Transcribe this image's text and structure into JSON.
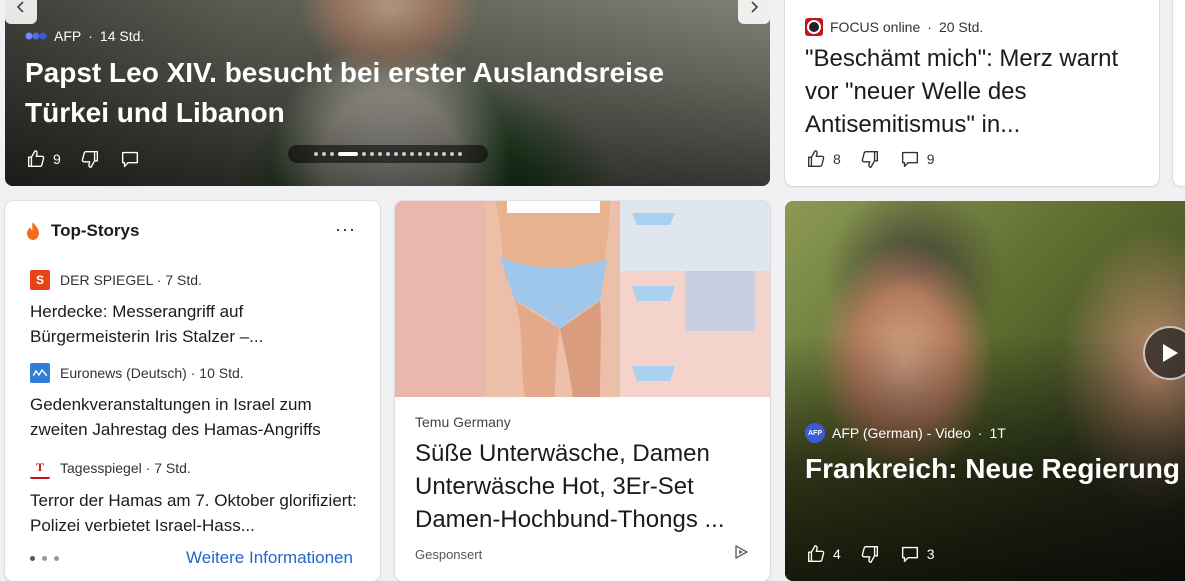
{
  "hero": {
    "source": "AFP",
    "time": "14 Std.",
    "title": "Papst Leo XIV. besucht bei erster Auslandsreise Türkei und Libanon",
    "likes": "9"
  },
  "focus": {
    "source": "FOCUS online",
    "time": "20 Std.",
    "title": "\"Beschämt mich\": Merz warnt vor \"neuer Welle des Antisemitismus\" in...",
    "likes": "8",
    "comments": "9"
  },
  "top_stories": {
    "heading": "Top-Storys",
    "more": "···",
    "items": [
      {
        "source": "DER SPIEGEL",
        "time": "7 Std.",
        "logo": "S",
        "logo_color": "#e64415",
        "title": "Herdecke: Messerangriff auf Bürgermeisterin Iris Stalzer –..."
      },
      {
        "source": "Euronews (Deutsch)",
        "time": "10 Std.",
        "logo": "",
        "logo_color": "#2f7dd6",
        "title": "Gedenkveranstaltungen in Israel zum zweiten Jahrestag des Hamas-Angriffs"
      },
      {
        "source": "Tagesspiegel",
        "time": "7 Std.",
        "logo": "T",
        "logo_color": "#c0161b",
        "title": "Terror der Hamas am 7. Oktober glorifiziert: Polizei verbietet Israel-Hass..."
      }
    ],
    "link": "Weitere Informationen"
  },
  "ad": {
    "brand": "Temu Germany",
    "title": "Süße Unterwäsche, Damen Unterwäsche Hot, 3Er-Set Damen-Hochbund-Thongs ...",
    "sponsored": "Gesponsert"
  },
  "video": {
    "source": "AFP (German) - Video",
    "time": "1T",
    "title": "Frankreich: Neue Regierung Gesichtern",
    "likes": "4",
    "comments": "3"
  },
  "colors": {
    "link": "#2266cc",
    "afp_blue": "#3a5bd9",
    "fire": "#f46b1d"
  }
}
